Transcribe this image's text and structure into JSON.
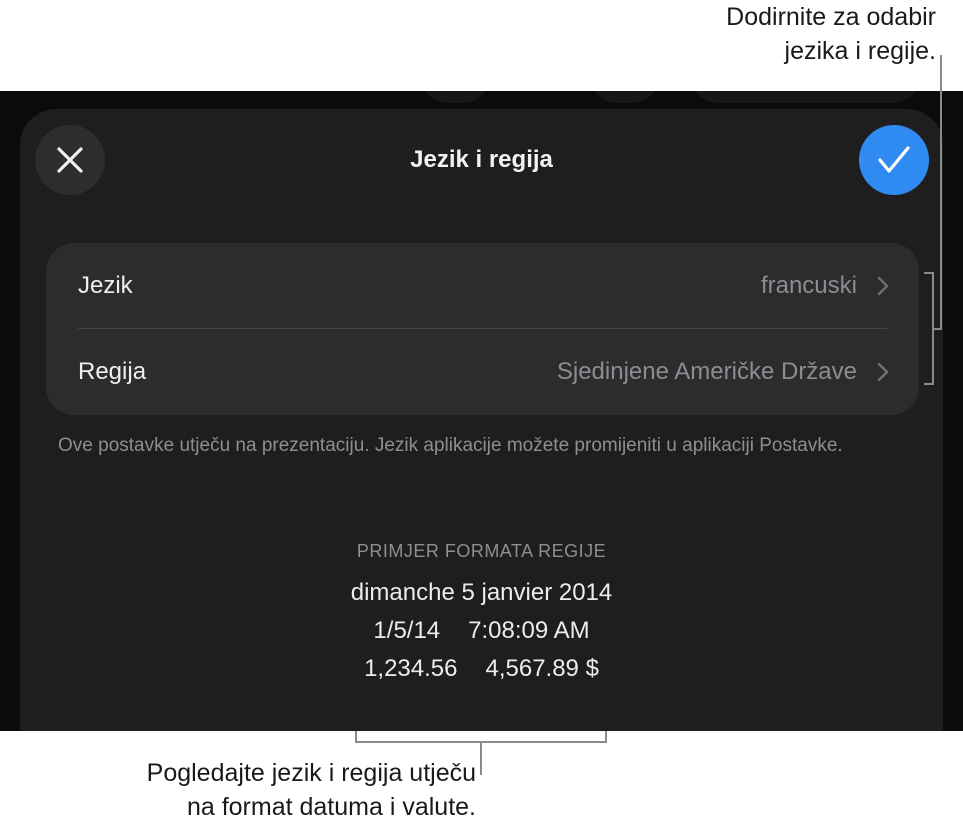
{
  "callouts": {
    "top_line1": "Dodirnite za odabir",
    "top_line2": "jezika i regije.",
    "bottom_line1": "Pogledajte jezik i regija utječu",
    "bottom_line2": "na format datuma i valute."
  },
  "sheet": {
    "title": "Jezik i regija",
    "close_icon": "close-icon",
    "confirm_icon": "checkmark-icon",
    "accent_color": "#2f8bf2"
  },
  "settings": {
    "language_label": "Jezik",
    "language_value": "francuski",
    "region_label": "Regija",
    "region_value": "Sjedinjene Američke Države"
  },
  "note": "Ove postavke utječu na prezentaciju. Jezik aplikacije možete promijeniti u aplikaciji Postavke.",
  "sample": {
    "header": "PRIMJER FORMATA REGIJE",
    "date_long": "dimanche 5 janvier 2014",
    "date_short": "1/5/14",
    "time": "7:08:09 AM",
    "number": "1,234.56",
    "currency": "4,567.89 $"
  }
}
